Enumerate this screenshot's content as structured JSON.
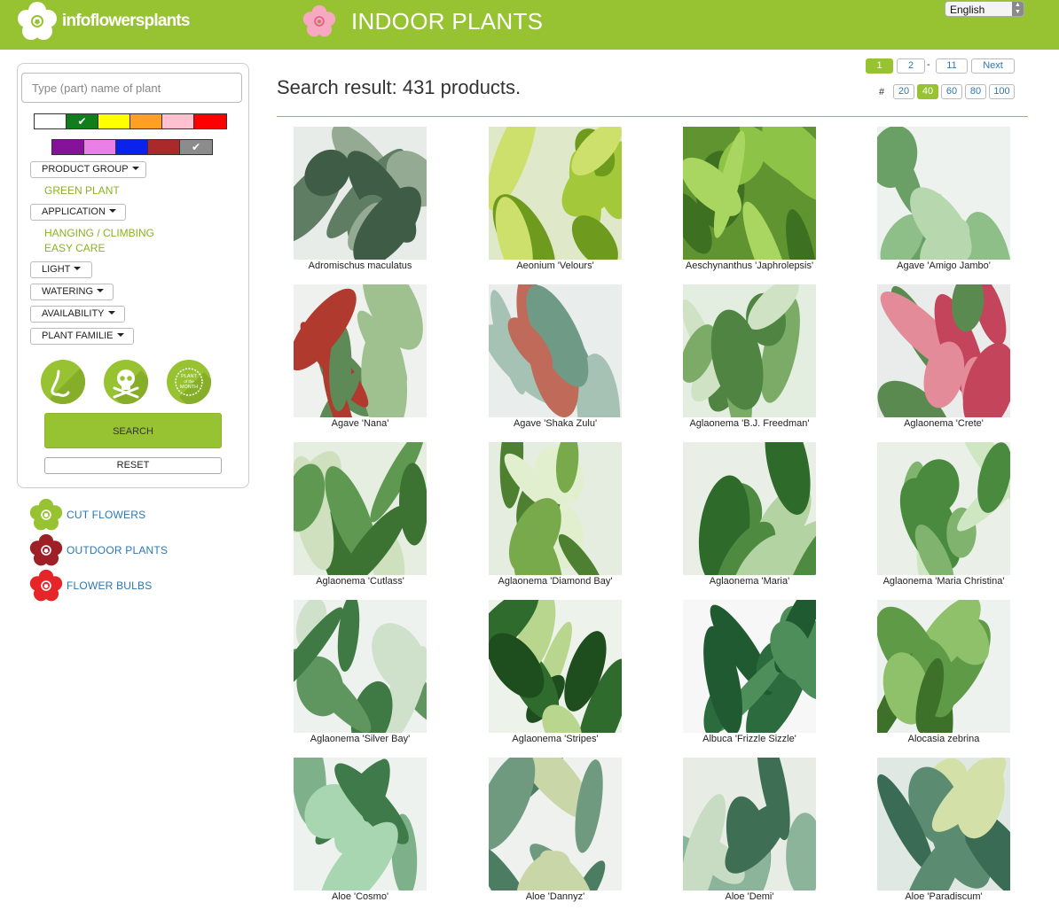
{
  "header": {
    "brand": "infoflowersplants",
    "section_title": "INDOOR PLANTS",
    "language": "English"
  },
  "search": {
    "placeholder": "Type (part) name of plant",
    "value": ""
  },
  "colors": {
    "brand_green": "#97c232",
    "row1": [
      {
        "color": "#ffffff",
        "checked": false
      },
      {
        "color": "#117d1c",
        "checked": true
      },
      {
        "color": "#ffff00",
        "checked": false
      },
      {
        "color": "#ffa023",
        "checked": false
      },
      {
        "color": "#ffc0cf",
        "checked": false
      },
      {
        "color": "#ff0000",
        "checked": false
      }
    ],
    "row2": [
      {
        "color": "#86119a",
        "checked": false
      },
      {
        "color": "#ea7fe6",
        "checked": false
      },
      {
        "color": "#0a22ec",
        "checked": false
      },
      {
        "color": "#a92a29",
        "checked": false
      },
      {
        "color": "#8c8c8c",
        "checked": true
      }
    ],
    "check_glyph": "✔"
  },
  "filters": {
    "product_group": "PRODUCT GROUP",
    "product_group_selected": [
      "GREEN PLANT"
    ],
    "application": "APPLICATION",
    "application_selected": [
      "HANGING / CLIMBING",
      "EASY CARE"
    ],
    "light": "LIGHT",
    "watering": "WATERING",
    "availability": "AVAILABILITY",
    "plant_familie": "PLANT FAMILIE"
  },
  "icons": [
    "nose-icon",
    "skull-icon",
    "plant-of-the-month-icon"
  ],
  "plant_of_month_badge": [
    "PLANT",
    "of the",
    "MONTH"
  ],
  "actions": {
    "search": "SEARCH",
    "reset": "RESET"
  },
  "nav": [
    {
      "label": "CUT FLOWERS",
      "color": "#97c232"
    },
    {
      "label": "OUTDOOR PLANTS",
      "color": "#9e2027"
    },
    {
      "label": "FLOWER BULBS",
      "color": "#e52528"
    }
  ],
  "results": {
    "title": "Search result: 431 products."
  },
  "pagination": {
    "pages": [
      "1",
      "2",
      "-",
      "11"
    ],
    "current": "1",
    "next": "Next",
    "per_page_label": "#",
    "per_page": [
      "20",
      "40",
      "60",
      "80",
      "100"
    ],
    "per_page_current": "40"
  },
  "products": [
    "Adromischus maculatus",
    "Aeonium 'Velours'",
    "Aeschynanthus 'Japhrolepsis'",
    "Agave 'Amigo Jambo'",
    "Agave 'Nana'",
    "Agave 'Shaka Zulu'",
    "Aglaonema 'B.J. Freedman'",
    "Aglaonema 'Crete'",
    "Aglaonema 'Cutlass'",
    "Aglaonema 'Diamond Bay'",
    "Aglaonema 'Maria'",
    "Aglaonema 'Maria Christina'",
    "Aglaonema 'Silver Bay'",
    "Aglaonema 'Stripes'",
    "Albuca 'Frizzle Sizzle'",
    "Alocasia zebrina",
    "Aloe 'Cosmo'",
    "Aloe 'Dannyz'",
    "Aloe 'Demi'",
    "Aloe 'Paradiscum'"
  ]
}
